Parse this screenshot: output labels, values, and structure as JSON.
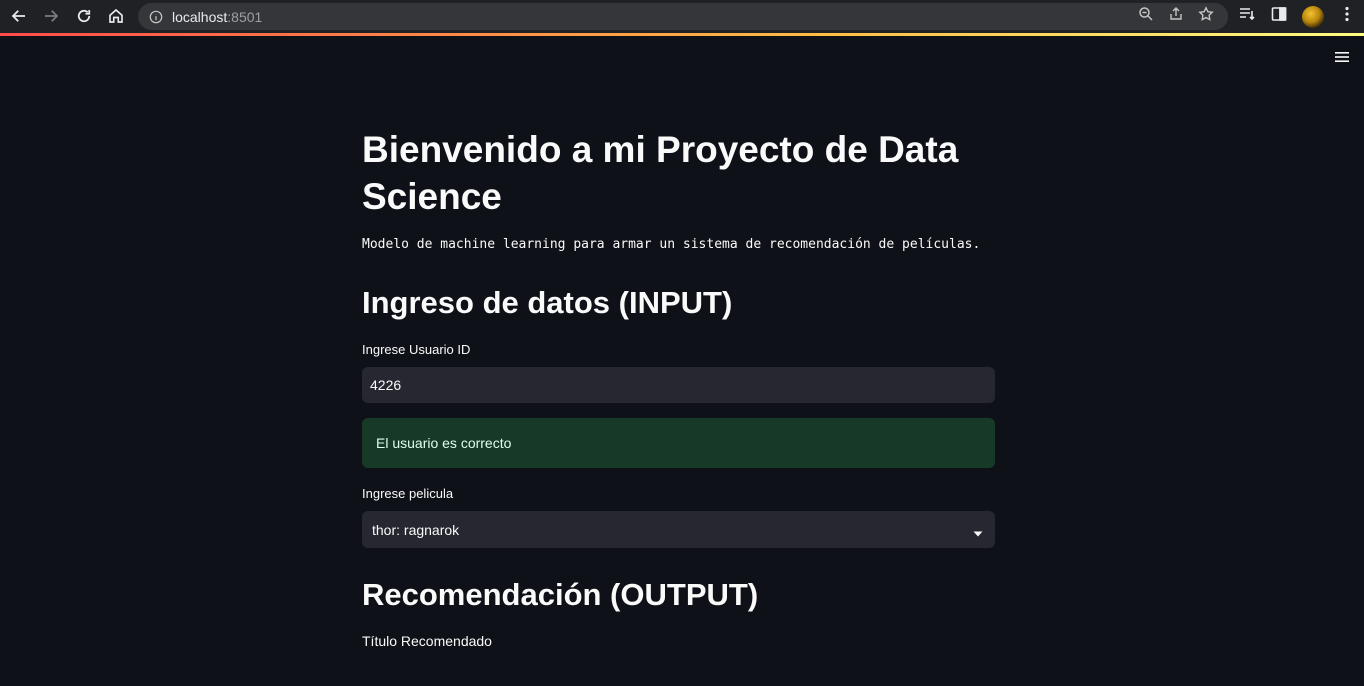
{
  "browser": {
    "url_host": "localhost",
    "url_port": ":8501"
  },
  "app": {
    "title": "Bienvenido a mi Proyecto de Data Science",
    "subtitle": "Modelo de machine learning para armar un sistema de recomendación de películas.",
    "input_header": "Ingreso de datos (INPUT)",
    "user_id_label": "Ingrese Usuario ID",
    "user_id_value": "4226",
    "success_message": "El usuario es correcto",
    "movie_label": "Ingrese pelicula",
    "movie_selected": "thor: ragnarok",
    "output_header": "Recomendación (OUTPUT)",
    "recommended_title_label": "Título Recomendado"
  },
  "colors": {
    "background": "#0e1117",
    "input_bg": "#262730",
    "success_bg": "#173928",
    "accent_gradient": [
      "#ff4b4b",
      "#ffbd45",
      "#fffd80"
    ]
  }
}
